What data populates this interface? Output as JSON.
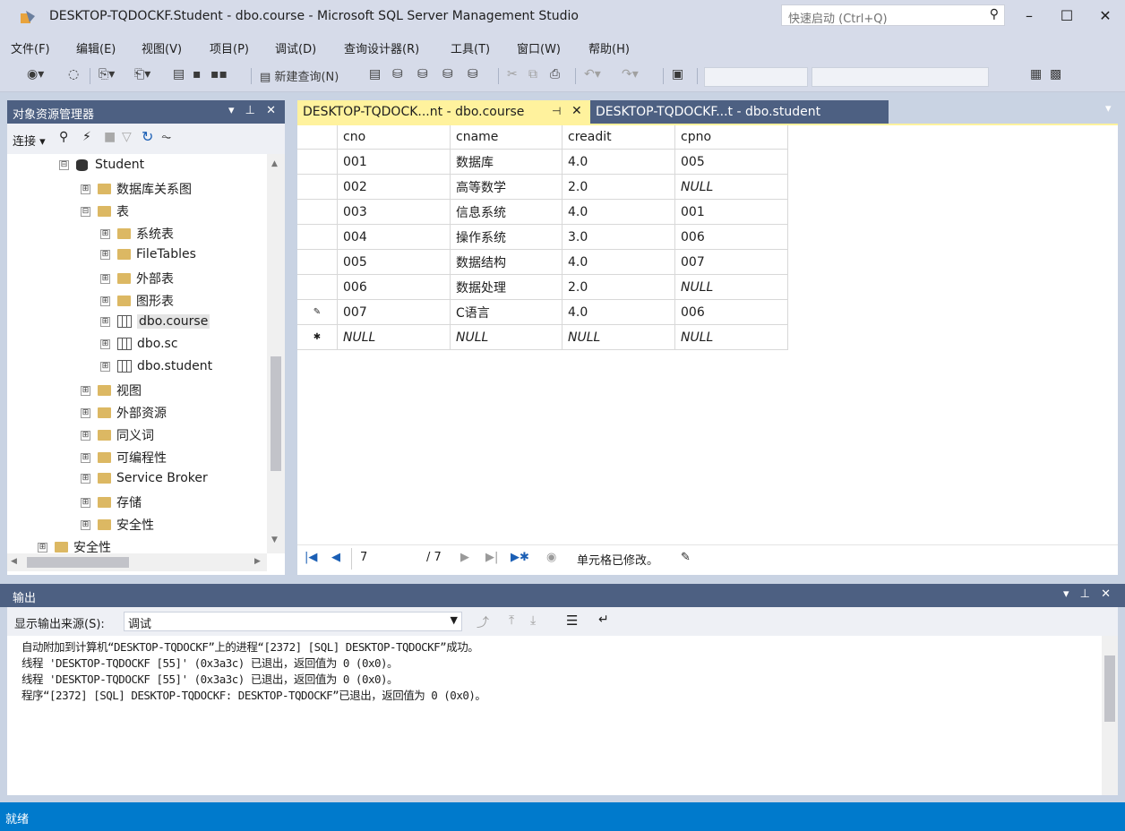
{
  "window": {
    "title": "DESKTOP-TQDOCKF.Student - dbo.course - Microsoft SQL Server Management Studio",
    "quick_launch_placeholder": "快速启动 (Ctrl+Q)",
    "minimize": "–",
    "maximize": "☐",
    "close": "✕"
  },
  "menu": [
    "文件(F)",
    "编辑(E)",
    "视图(V)",
    "项目(P)",
    "调试(D)",
    "查询设计器(R)",
    "工具(T)",
    "窗口(W)",
    "帮助(H)"
  ],
  "toolbar": {
    "new_query": "新建查询(N)"
  },
  "object_explorer": {
    "title": "对象资源管理器",
    "controls": "▾ ⊥ ✕",
    "connect": "连接 ▾",
    "tree": [
      {
        "label": "Student",
        "icon": "database-icon",
        "expander": "⊟"
      },
      {
        "label": "数据库关系图",
        "icon": "folder-icon",
        "expander": "⊞"
      },
      {
        "label": "表",
        "icon": "folder-icon",
        "expander": "⊟"
      },
      {
        "label": "系统表",
        "icon": "folder-icon",
        "expander": "⊞"
      },
      {
        "label": "FileTables",
        "icon": "folder-icon",
        "expander": "⊞"
      },
      {
        "label": "外部表",
        "icon": "folder-icon",
        "expander": "⊞"
      },
      {
        "label": "图形表",
        "icon": "folder-icon",
        "expander": "⊞"
      },
      {
        "label": "dbo.course",
        "icon": "table-icon",
        "expander": "⊞"
      },
      {
        "label": "dbo.sc",
        "icon": "table-icon",
        "expander": "⊞"
      },
      {
        "label": "dbo.student",
        "icon": "table-icon",
        "expander": "⊞"
      },
      {
        "label": "视图",
        "icon": "folder-icon",
        "expander": "⊞"
      },
      {
        "label": "外部资源",
        "icon": "folder-icon",
        "expander": "⊞"
      },
      {
        "label": "同义词",
        "icon": "folder-icon",
        "expander": "⊞"
      },
      {
        "label": "可编程性",
        "icon": "folder-icon",
        "expander": "⊞"
      },
      {
        "label": "Service Broker",
        "icon": "folder-icon",
        "expander": "⊞"
      },
      {
        "label": "存储",
        "icon": "folder-icon",
        "expander": "⊞"
      },
      {
        "label": "安全性",
        "icon": "folder-icon",
        "expander": "⊞"
      },
      {
        "label": "安全性",
        "icon": "folder-icon",
        "expander": "⊞"
      }
    ]
  },
  "tabs": [
    {
      "label": "DESKTOP-TQDOCK...nt - dbo.course",
      "pin": "⊣",
      "close": "✕"
    },
    {
      "label": "DESKTOP-TQDOCKF...t - dbo.student"
    }
  ],
  "grid": {
    "columns": [
      "cno",
      "cname",
      "creadit",
      "cpno"
    ],
    "rows": [
      {
        "marker": "",
        "cells": [
          "001",
          "数据库",
          "4.0",
          "005"
        ]
      },
      {
        "marker": "",
        "cells": [
          "002",
          "高等数学",
          "2.0",
          "NULL"
        ]
      },
      {
        "marker": "",
        "cells": [
          "003",
          "信息系统",
          "4.0",
          "001"
        ]
      },
      {
        "marker": "",
        "cells": [
          "004",
          "操作系统",
          "3.0",
          "006"
        ]
      },
      {
        "marker": "",
        "cells": [
          "005",
          "数据结构",
          "4.0",
          "007"
        ]
      },
      {
        "marker": "",
        "cells": [
          "006",
          "数据处理",
          "2.0",
          "NULL"
        ]
      },
      {
        "marker": "✎",
        "cells": [
          "007",
          "C语言",
          "4.0",
          "006"
        ]
      },
      {
        "marker": "✱",
        "cells": [
          "NULL",
          "NULL",
          "NULL",
          "NULL"
        ]
      }
    ]
  },
  "navigator": {
    "current": "7",
    "total": "/ 7",
    "status": "单元格已修改。"
  },
  "output": {
    "title": "输出",
    "source_label": "显示输出来源(S):",
    "source_value": "调试",
    "lines": [
      "自动附加到计算机“DESKTOP-TQDOCKF”上的进程“[2372] [SQL] DESKTOP-TQDOCKF”成功。",
      "线程 'DESKTOP-TQDOCKF [55]' (0x3a3c) 已退出，返回值为 0 (0x0)。",
      "线程 'DESKTOP-TQDOCKF [55]' (0x3a3c) 已退出，返回值为 0 (0x0)。",
      "程序“[2372] [SQL] DESKTOP-TQDOCKF: DESKTOP-TQDOCKF”已退出，返回值为 0 (0x0)。"
    ]
  },
  "status_bar": {
    "text": "就绪"
  },
  "colors": {
    "accent": "#007acc",
    "tab_active": "#fff29d",
    "panel_header": "#4d6082"
  }
}
